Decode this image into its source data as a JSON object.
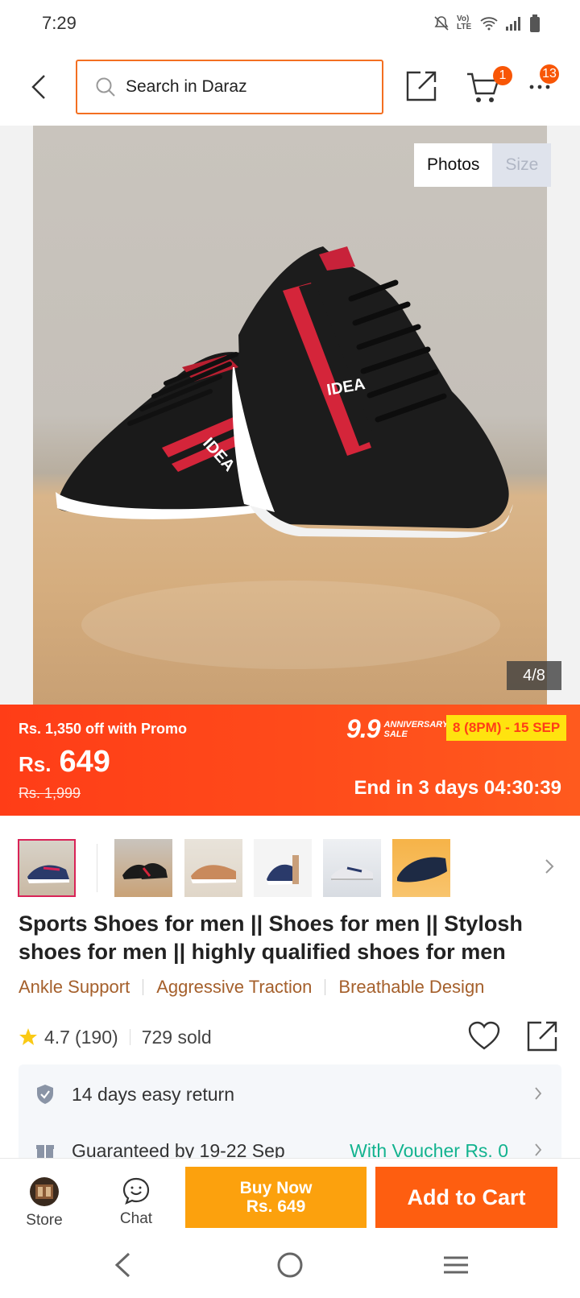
{
  "status_bar": {
    "time": "7:29",
    "network_label": "Vo) LTE"
  },
  "header": {
    "search_placeholder": "Search in Daraz",
    "cart_count": "1",
    "more_count": "13"
  },
  "gallery": {
    "tabs": [
      "Photos",
      "Size"
    ],
    "active_tab": "Photos",
    "counter": "4/8",
    "shoe_brand": "IDEA"
  },
  "price": {
    "promo": "Rs. 1,350 off with Promo",
    "currency": "Rs.",
    "value": "649",
    "original": "Rs. 1,999",
    "sale_logo_number": "9.9",
    "sale_logo_text_1": "ANNIVERSARY",
    "sale_logo_text_2": "SALE",
    "sale_dates": "8 (8PM) - 15 SEP",
    "countdown": "End in 3 days 04:30:39"
  },
  "product": {
    "title": "Sports Shoes for men || Shoes for men || Stylosh shoes for men || highly qualified shoes for men",
    "features": [
      "Ankle Support",
      "Aggressive Traction",
      "Breathable Design"
    ],
    "rating": "4.7",
    "rating_count": "(190)",
    "sold": "729 sold"
  },
  "services": {
    "return": "14 days easy return",
    "delivery": "Guaranteed by 19-22 Sep",
    "voucher": "With Voucher Rs. 0"
  },
  "actions": {
    "store": "Store",
    "chat": "Chat",
    "buy_now_line1": "Buy Now",
    "buy_now_line2": "Rs. 649",
    "add_to_cart": "Add to Cart"
  },
  "colors": {
    "brand": "#f85606",
    "accent_orange": "#fca10d",
    "promo_red": "#ff3d17",
    "feature_brown": "#a5602c",
    "voucher_green": "#13b38f"
  }
}
